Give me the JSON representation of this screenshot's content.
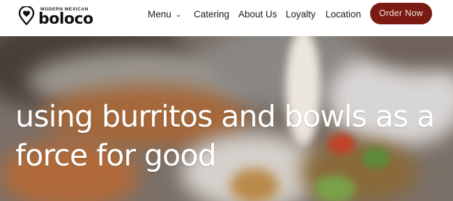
{
  "brand": {
    "tagline": "MODERN MEXICAN",
    "name": "boloco"
  },
  "nav": {
    "items": [
      {
        "label": "Menu",
        "icon": "chevron-down-icon"
      },
      {
        "label": "Catering"
      },
      {
        "label": "About Us"
      },
      {
        "label": "Loyalty"
      },
      {
        "label": "Location"
      }
    ],
    "cta": "Order Now"
  },
  "hero": {
    "headline": "using burritos and bowls as a force for good"
  },
  "colors": {
    "accent": "#7a1a12",
    "header_bg": "#ffffff",
    "headline_text": "#ffffff"
  }
}
